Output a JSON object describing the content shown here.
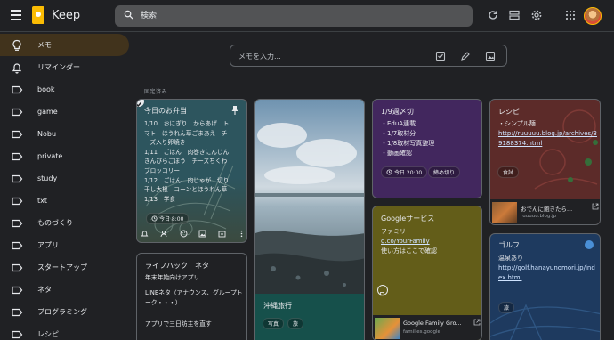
{
  "header": {
    "app_name": "Keep",
    "search_placeholder": "検索"
  },
  "sidebar": {
    "items": [
      {
        "label": "メモ",
        "icon": "lightbulb-icon",
        "active": true
      },
      {
        "label": "リマインダー",
        "icon": "bell-icon"
      },
      {
        "label": "book",
        "icon": "label-icon"
      },
      {
        "label": "game",
        "icon": "label-icon"
      },
      {
        "label": "Nobu",
        "icon": "label-icon"
      },
      {
        "label": "private",
        "icon": "label-icon"
      },
      {
        "label": "study",
        "icon": "label-icon"
      },
      {
        "label": "txt",
        "icon": "label-icon"
      },
      {
        "label": "ものづくり",
        "icon": "label-icon"
      },
      {
        "label": "アプリ",
        "icon": "label-icon"
      },
      {
        "label": "スタートアップ",
        "icon": "label-icon"
      },
      {
        "label": "ネタ",
        "icon": "label-icon"
      },
      {
        "label": "プログラミング",
        "icon": "label-icon"
      },
      {
        "label": "レシピ",
        "icon": "label-icon"
      }
    ]
  },
  "take_note": {
    "placeholder": "メモを入力..."
  },
  "pinned_label": "固定済み",
  "notes": {
    "bento": {
      "title": "今日のお弁当",
      "body": "1/10　おにぎり　からあげ　ト\nマト　ほうれん草ごまあえ　チ\nーズ入り卵焼き\n1/11　ごはん　肉巻きにんじん\nきんぴらごぼう　チーズちくわ\nブロッコリー\n1/12　ごはん　肉じゃが　切り\n干し大根　コーンとほうれん草\n1/13　学食",
      "reminder": "今日 8:00",
      "color": "#2d555e"
    },
    "lifehack": {
      "title": "ライフハック　ネタ",
      "items": [
        "年末年始向けアプリ",
        "LINEネタ（アナウンス、グループトーク・・・）",
        "アプリで三日坊主を直す"
      ]
    },
    "okinawa": {
      "title": "沖縄旅行",
      "labels": [
        "写真",
        "旅"
      ],
      "color": "#16504b"
    },
    "deadline": {
      "title": "1/9週〆切",
      "items": [
        "・EduA連載",
        "・1/7取材分",
        "・1/8取材写真整理",
        "・動画確認"
      ],
      "chips": [
        "今日 20:00",
        "締め切り"
      ],
      "color": "#42275e"
    },
    "google": {
      "title": "Googleサービス",
      "body": "ファミリー",
      "link": "g.co/YourFamily",
      "body2": "使い方はここで確認",
      "preview_title": "Google Family Gro...",
      "preview_domain": "families.google",
      "color": "#635d19"
    },
    "recipe": {
      "title": "レシピ",
      "body": "・シンプル麺",
      "link": "http://ruuuuu.blog.jp/archives/39188374.html",
      "label": "食試",
      "preview_title": "おでんに飽きたら...",
      "preview_domain": "ruuuuu.blog.jp",
      "color": "#5c2b29"
    },
    "golf": {
      "title": "ゴルフ",
      "body": "温泉あり",
      "link": "http://golf.hanayunomori.jp/index.html",
      "label": "旅",
      "color": "#1e3a5f"
    }
  },
  "colors": {
    "background": "#202124",
    "accent": "#fbbc04",
    "active_item": "#41331c"
  }
}
